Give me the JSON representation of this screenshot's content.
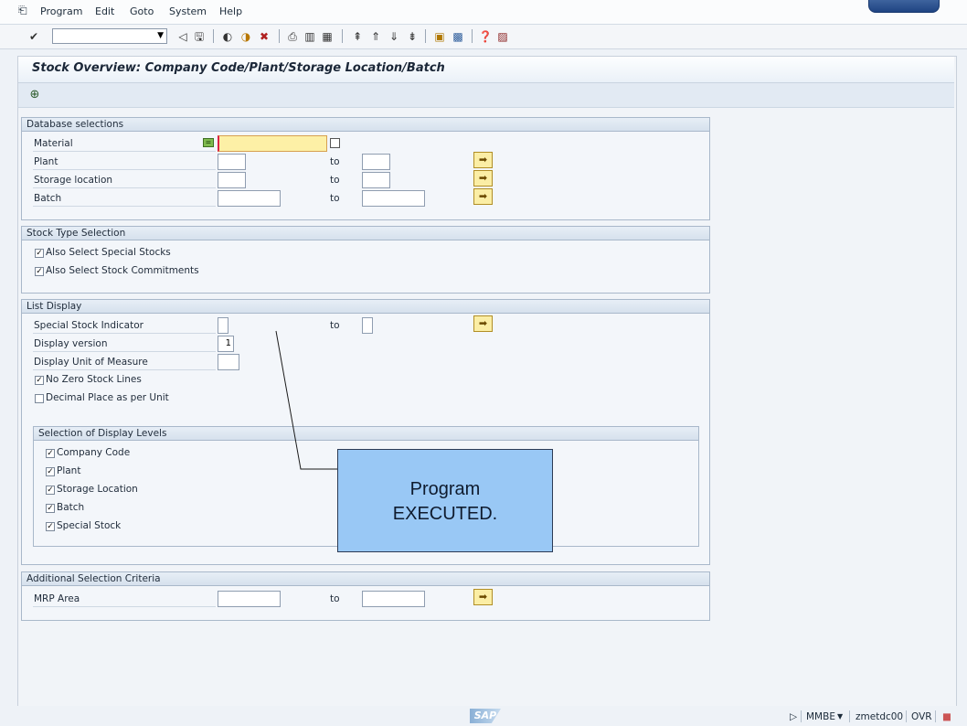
{
  "menu": [
    {
      "key": "program",
      "label": "Program"
    },
    {
      "key": "edit",
      "label": "Edit"
    },
    {
      "key": "goto",
      "label": "Goto"
    },
    {
      "key": "system",
      "label": "System"
    },
    {
      "key": "help",
      "label": "Help"
    }
  ],
  "screen": {
    "title": "Stock Overview: Company Code/Plant/Storage Location/Batch"
  },
  "database_selections": {
    "header": "Database selections",
    "rows": [
      {
        "label": "Material",
        "from": "",
        "to": null
      },
      {
        "label": "Plant",
        "from": "",
        "to_label": "to",
        "to": ""
      },
      {
        "label": "Storage location",
        "from": "",
        "to_label": "to",
        "to": ""
      },
      {
        "label": "Batch",
        "from": "",
        "to_label": "to",
        "to": ""
      }
    ],
    "multi_tag": "="
  },
  "stock_type": {
    "header": "Stock Type Selection",
    "options": [
      {
        "label": "Also Select Special Stocks",
        "checked": true
      },
      {
        "label": "Also Select Stock Commitments",
        "checked": true
      }
    ]
  },
  "list_display": {
    "header": "List Display",
    "special_stock_label": "Special Stock Indicator",
    "to_label": "to",
    "display_version_label": "Display version",
    "display_version_value": "1",
    "display_uom_label": "Display Unit of Measure",
    "options": [
      {
        "label": "No Zero Stock Lines",
        "checked": true
      },
      {
        "label": "Decimal Place as per Unit",
        "checked": false
      }
    ],
    "levels_header": "Selection of Display Levels",
    "levels": [
      {
        "label": "Company Code",
        "checked": true
      },
      {
        "label": "Plant",
        "checked": true
      },
      {
        "label": "Storage Location",
        "checked": true
      },
      {
        "label": "Batch",
        "checked": true
      },
      {
        "label": "Special Stock",
        "checked": true
      }
    ]
  },
  "additional": {
    "header": "Additional Selection Criteria",
    "mrp_label": "MRP Area",
    "to_label": "to"
  },
  "callout": {
    "text": "Program\nEXECUTED."
  },
  "status": {
    "logo": "SAP",
    "transaction": "MMBE",
    "server": "zmetdc00",
    "mode": "OVR"
  },
  "icons": {
    "checkmark": "check-icon",
    "save": "save-icon",
    "back": "back-icon",
    "exit": "exit-icon",
    "cancel": "cancel-icon",
    "print": "print-icon",
    "find": "find-icon",
    "find_next": "find-next-icon",
    "execute": "execute-icon",
    "multiple_selection": "multiple-selection-arrow-icon",
    "help": "help-icon"
  }
}
